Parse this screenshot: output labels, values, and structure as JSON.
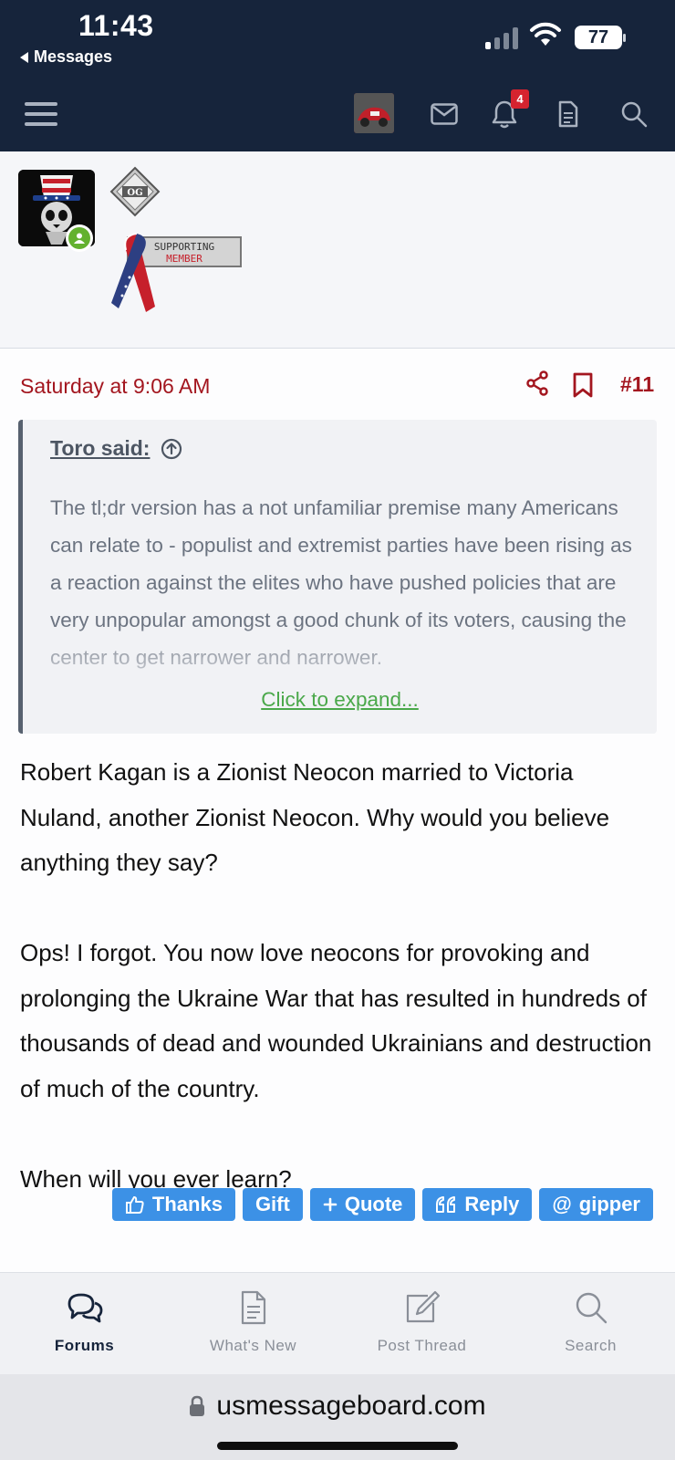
{
  "status_bar": {
    "time": "11:43",
    "back_label": "Messages",
    "battery": "77"
  },
  "nav": {
    "notification_count": "4"
  },
  "post": {
    "date": "Saturday at 9:06 AM",
    "number": "#11",
    "quote": {
      "author": "Toro said:",
      "text": "The tl;dr version has a not unfamiliar premise many Americans can relate to - populist and extremist parties have been rising as a reaction against the elites who have pushed policies that are very unpopular amongst a good chunk of its voters, causing the center to get narrower and narrower.",
      "expand_label": "Click to expand..."
    },
    "body": [
      "Robert Kagan is a Zionist Neocon married to Victoria Nuland, another Zionist Neocon. Why would you believe anything they say?",
      "Ops! I forgot. You now love neocons for provoking and prolonging the Ukraine War that has resulted in hundreds of thousands of dead and wounded Ukrainians and destruction of much of the country.",
      "When will you ever learn?"
    ],
    "actions": {
      "thanks": "Thanks",
      "gift": "Gift",
      "quote": "Quote",
      "reply": "Reply",
      "mention": "gipper"
    }
  },
  "profile": {
    "badge_og": "OG",
    "ribbon_line1": "SUPPORTING",
    "ribbon_line2": "MEMBER"
  },
  "tabs": [
    {
      "label": "Forums",
      "icon": "chat-bubbles-icon",
      "active": true
    },
    {
      "label": "What's New",
      "icon": "document-icon",
      "active": false
    },
    {
      "label": "Post Thread",
      "icon": "compose-icon",
      "active": false
    },
    {
      "label": "Search",
      "icon": "search-icon",
      "active": false
    }
  ],
  "browser": {
    "url": "usmessageboard.com"
  },
  "colors": {
    "header_bg": "#16243b",
    "accent_red": "#a3161f",
    "button_blue": "#3c91e6",
    "link_green": "#4aa84a"
  }
}
